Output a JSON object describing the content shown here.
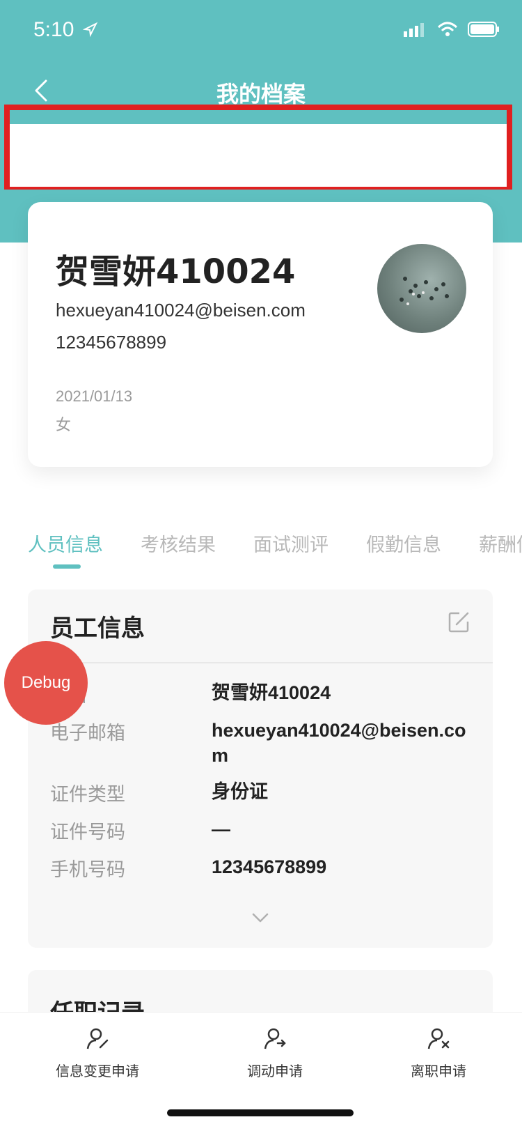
{
  "status_bar": {
    "time": "5:10"
  },
  "nav": {
    "title": "我的档案"
  },
  "profile": {
    "name": "贺雪妍410024",
    "email": "hexueyan410024@beisen.com",
    "phone": "12345678899",
    "date": "2021/01/13",
    "gender": "女"
  },
  "tabs": [
    {
      "label": "人员信息"
    },
    {
      "label": "考核结果"
    },
    {
      "label": "面试测评"
    },
    {
      "label": "假勤信息"
    },
    {
      "label": "薪酬信息"
    }
  ],
  "employee_info": {
    "title": "员工信息",
    "rows": [
      {
        "label": "姓名",
        "value": "贺雪妍410024"
      },
      {
        "label": "电子邮箱",
        "value": "hexueyan410024@beisen.com"
      },
      {
        "label": "证件类型",
        "value": "身份证"
      },
      {
        "label": "证件号码",
        "value": "—"
      },
      {
        "label": "手机号码",
        "value": "12345678899"
      }
    ]
  },
  "record": {
    "title": "任职记录"
  },
  "debug": {
    "label": "Debug"
  },
  "bottom_actions": [
    {
      "label": "信息变更申请",
      "icon": "person-edit-icon"
    },
    {
      "label": "调动申请",
      "icon": "person-transfer-icon"
    },
    {
      "label": "离职申请",
      "icon": "person-remove-icon"
    }
  ],
  "colors": {
    "accent": "#5fc0c0",
    "highlight": "#e02020",
    "debug": "#e5524a"
  }
}
